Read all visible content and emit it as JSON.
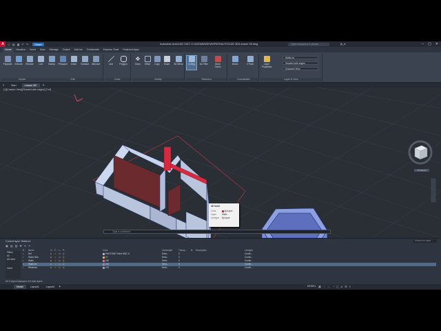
{
  "titlebar": {
    "logo": "A",
    "share": "Share",
    "title": "Autodesk AutoCAD 2027  C:\\DATABASE\\WORKS\\AUTOCAD 3D\\Lesson 06.dwg",
    "search_placeholder": "Type a keyword or phrase",
    "user": "jk_d"
  },
  "tabs": [
    "Home",
    "Visualize",
    "Insert",
    "View",
    "Manage",
    "Output",
    "Add-ins",
    "Collaborate",
    "Express Tools",
    "Featured Apps"
  ],
  "ribbon": {
    "create": {
      "label": "Create",
      "tools": [
        "Polysolid",
        "Extrude",
        "Revolve",
        "Loft",
        "Sweep",
        "Presspull",
        "Union",
        "Subtract",
        "Intersect"
      ]
    },
    "edit": {
      "label": "Edit"
    },
    "draw": {
      "label": "Draw",
      "tools": [
        "Line",
        "Polygon"
      ]
    },
    "modify": {
      "label": "Modify",
      "tools": [
        "Move",
        "Offset",
        "Copy",
        "Erase",
        "3D Mirror"
      ]
    },
    "selection": {
      "label": "Selection",
      "tools": [
        "Culling",
        "No Filter",
        "Move Gizmo"
      ]
    },
    "coordinates": {
      "label": "Coordinates",
      "tools": [
        "World",
        "3 Point"
      ]
    },
    "layers": {
      "label": "Layer & View",
      "tools": [
        "Layer Properties"
      ],
      "layer_dd": "Walls Int",
      "visual_dd": "Shaded with edges",
      "view_dd": "Unsaved View"
    }
  },
  "doctabs": [
    "Start",
    "Lesson 06*"
  ],
  "viewport": {
    "label": "[+][Custom View][Shaded with edges] [Fort]",
    "command_placeholder": "Type a command",
    "cube_label": "Unnamed"
  },
  "tooltip": {
    "title": "3D Solid",
    "rows": [
      {
        "k": "Color",
        "v": "ByLayer"
      },
      {
        "k": "Layer",
        "v": "Walls"
      },
      {
        "k": "Linetype",
        "v": "ByLayer"
      }
    ]
  },
  "layers": {
    "header": "Current layer: Walls Int",
    "search_placeholder": "Search for layer",
    "filters_title": "Filters",
    "filter_items": [
      "All",
      "All Used"
    ],
    "invert": "Invert",
    "columns": [
      "S..",
      "Name",
      "O..",
      "F..",
      "L..",
      "P..",
      "Color",
      "Lineweight",
      "Transp...",
      "N..",
      "Description",
      "Linetype"
    ],
    "rows": [
      {
        "name": "Ref",
        "color": "PANTONE Violet 0631 U",
        "swatch": "#c9a0dc",
        "lw": "Defa...",
        "tr": "0",
        "lt": "Contin...",
        "hl": false
      },
      {
        "name": "Stairs Ras",
        "color": "27",
        "swatch": "#ff9f5a",
        "lw": "Defa...",
        "tr": "0",
        "lt": "Contin...",
        "hl": false
      },
      {
        "name": "Walls",
        "color": "240",
        "swatch": "#ff5f7f",
        "lw": "Defa...",
        "tr": "0",
        "lt": "Contin...",
        "hl": false
      },
      {
        "name": "Walls Int",
        "color": "241",
        "swatch": "#bf7f8f",
        "lw": "Defa...",
        "tr": "0",
        "lt": "Contin...",
        "hl": true
      },
      {
        "name": "Windows",
        "color": "161",
        "swatch": "#7f9fff",
        "lw": "Defa...",
        "tr": "0",
        "lt": "Contin...",
        "hl": false
      }
    ],
    "status": "All: 8 layers displayed of 8 total layers"
  },
  "statusbar": {
    "tabs": [
      "Model",
      "Layout1",
      "Layout2"
    ],
    "model": "MODEL"
  },
  "colors": {
    "accent": "#2f6fb5",
    "wall_face": "#b9c4dd",
    "wall_top": "#c9d4ec",
    "wall_edge": "#1a2f66",
    "int_wall": "#6a2a2e"
  }
}
